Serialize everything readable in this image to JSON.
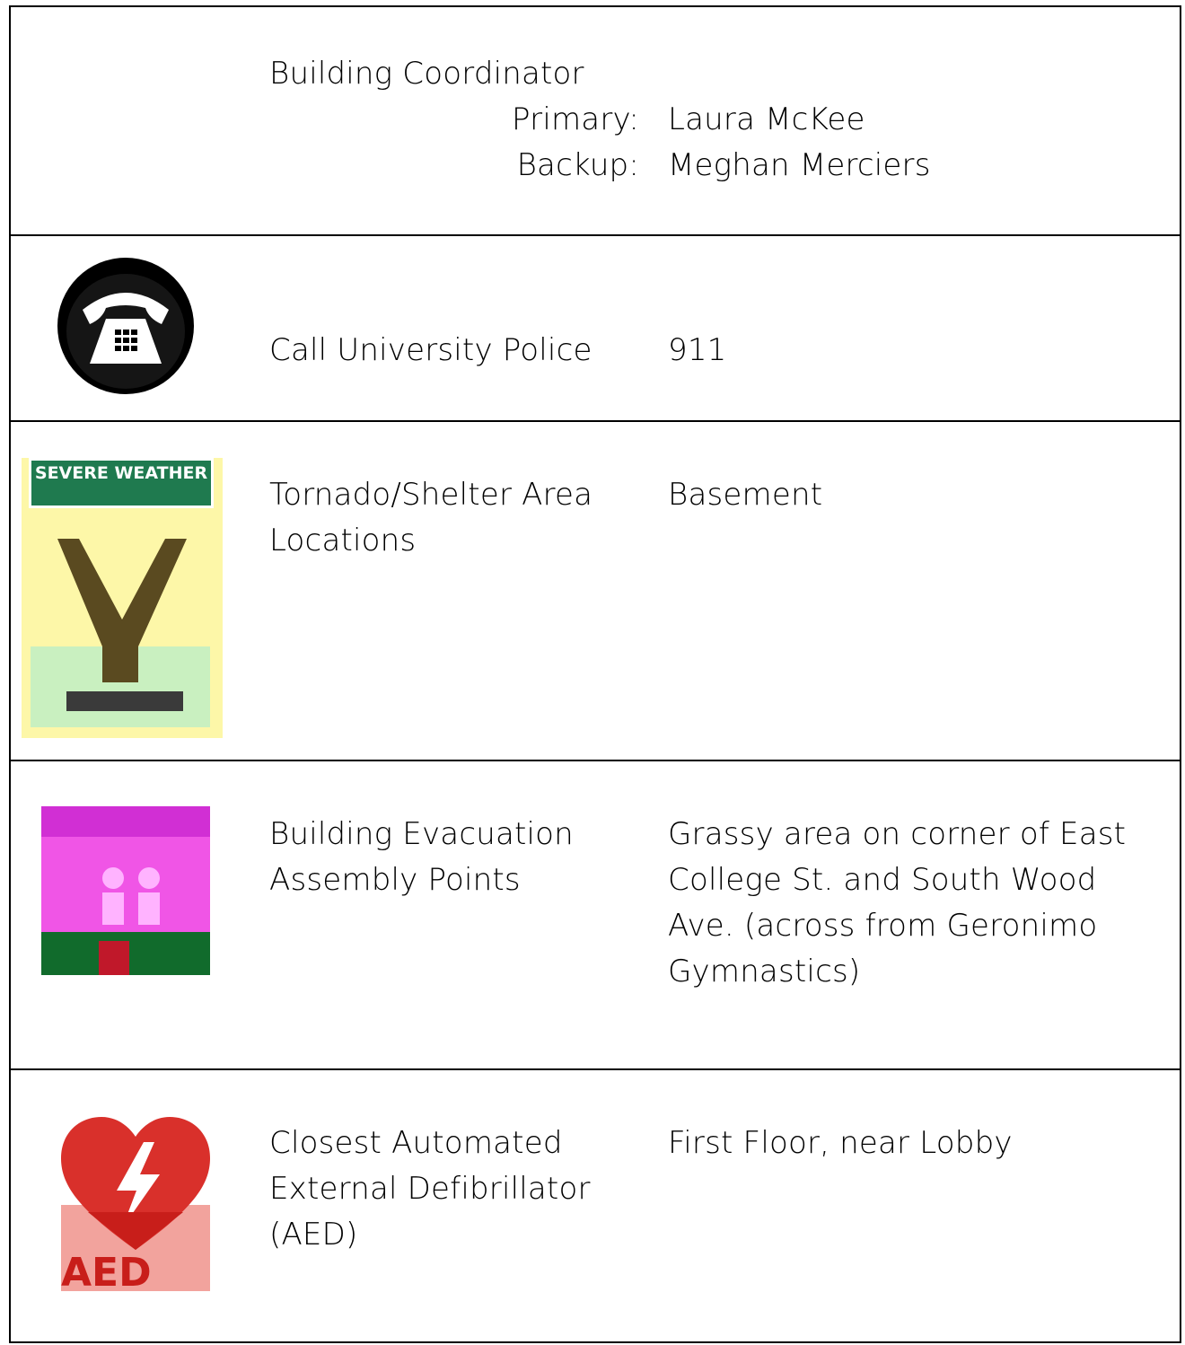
{
  "coordinator": {
    "title": "Building Coordinator",
    "primary_label": "Primary:",
    "primary_name": "Laura McKee",
    "backup_label": "Backup:",
    "backup_name": "Meghan Merciers"
  },
  "rows": [
    {
      "icon": "telephone-icon",
      "label": "Call University Police",
      "value": "911"
    },
    {
      "icon": "severe-weather-sign-icon",
      "label": "Tornado/Shelter Area Locations",
      "value": "Basement"
    },
    {
      "icon": "evacuation-assembly-icon",
      "label": "Building Evacuation Assembly Points",
      "value": "Grassy area on corner of East College St. and South Wood Ave. (across from Geronimo Gymnastics)"
    },
    {
      "icon": "aed-heart-icon",
      "label": "Closest Automated External Defibrillator (AED)",
      "value": "First Floor, near Lobby"
    }
  ],
  "icon_texts": {
    "weather_sign": "SEVERE WEATHER",
    "aed": "AED"
  },
  "colors": {
    "border": "#000000",
    "weather_green": "#1f7a4f",
    "weather_yellow": "#fdf7a8",
    "aed_red": "#d9302b",
    "evac_pink": "#f055e6",
    "evac_green": "#116b2c"
  }
}
